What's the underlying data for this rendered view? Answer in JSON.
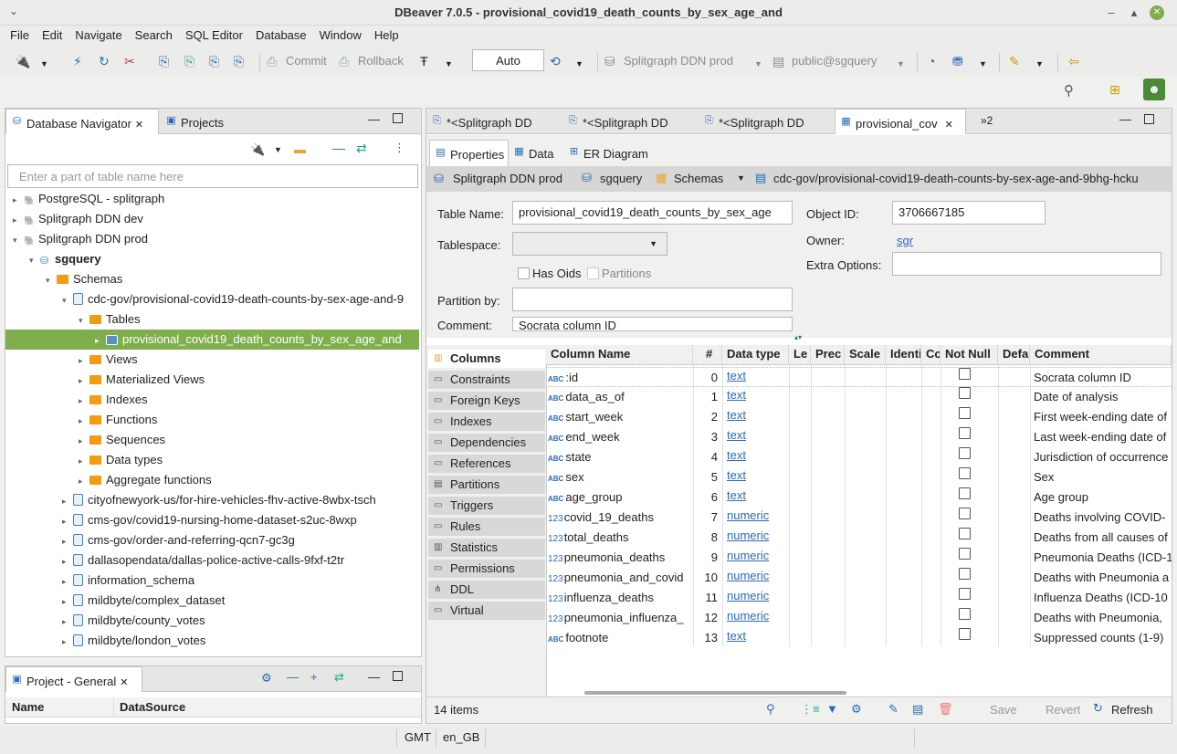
{
  "window": {
    "title": "DBeaver 7.0.5 - provisional_covid19_death_counts_by_sex_age_and",
    "min": "–",
    "max": "▴",
    "close": "✕"
  },
  "menu": [
    "File",
    "Edit",
    "Navigate",
    "Search",
    "SQL Editor",
    "Database",
    "Window",
    "Help"
  ],
  "toolbar": {
    "commit": "Commit",
    "rollback": "Rollback",
    "mode": "Auto",
    "connection": "Splitgraph DDN prod",
    "schema": "public@sgquery"
  },
  "navigator": {
    "tab": "Database Navigator",
    "tab2": "Projects",
    "filter_placeholder": "Enter a part of table name here",
    "rows": [
      {
        "label": "PostgreSQL - splitgraph",
        "lvl": 0,
        "kind": "db",
        "arrow": "▸"
      },
      {
        "label": "Splitgraph DDN dev",
        "lvl": 0,
        "kind": "db",
        "arrow": "▸"
      },
      {
        "label": "Splitgraph DDN prod",
        "lvl": 0,
        "kind": "db",
        "arrow": "▾"
      },
      {
        "label": "sgquery",
        "lvl": 1,
        "kind": "sg",
        "arrow": "▾"
      },
      {
        "label": "Schemas",
        "lvl": 2,
        "kind": "fold",
        "arrow": "▾"
      },
      {
        "label": "cdc-gov/provisional-covid19-death-counts-by-sex-age-and-9",
        "lvl": 3,
        "kind": "sch",
        "arrow": "▾"
      },
      {
        "label": "Tables",
        "lvl": 4,
        "kind": "fold",
        "arrow": "▾"
      },
      {
        "label": "provisional_covid19_death_counts_by_sex_age_and",
        "lvl": 5,
        "kind": "tbl",
        "arrow": "▸",
        "sel": true
      },
      {
        "label": "Views",
        "lvl": 4,
        "kind": "fold",
        "arrow": "▸"
      },
      {
        "label": "Materialized Views",
        "lvl": 4,
        "kind": "fold",
        "arrow": "▸"
      },
      {
        "label": "Indexes",
        "lvl": 4,
        "kind": "fold",
        "arrow": "▸"
      },
      {
        "label": "Functions",
        "lvl": 4,
        "kind": "fold",
        "arrow": "▸"
      },
      {
        "label": "Sequences",
        "lvl": 4,
        "kind": "fold",
        "arrow": "▸"
      },
      {
        "label": "Data types",
        "lvl": 4,
        "kind": "fold",
        "arrow": "▸"
      },
      {
        "label": "Aggregate functions",
        "lvl": 4,
        "kind": "fold",
        "arrow": "▸"
      },
      {
        "label": "cityofnewyork-us/for-hire-vehicles-fhv-active-8wbx-tsch",
        "lvl": 3,
        "kind": "sch",
        "arrow": "▸"
      },
      {
        "label": "cms-gov/covid19-nursing-home-dataset-s2uc-8wxp",
        "lvl": 3,
        "kind": "sch",
        "arrow": "▸"
      },
      {
        "label": "cms-gov/order-and-referring-qcn7-gc3g",
        "lvl": 3,
        "kind": "sch",
        "arrow": "▸"
      },
      {
        "label": "dallasopendata/dallas-police-active-calls-9fxf-t2tr",
        "lvl": 3,
        "kind": "sch",
        "arrow": "▸"
      },
      {
        "label": "information_schema",
        "lvl": 3,
        "kind": "sch",
        "arrow": "▸"
      },
      {
        "label": "mildbyte/complex_dataset",
        "lvl": 3,
        "kind": "sch",
        "arrow": "▸"
      },
      {
        "label": "mildbyte/county_votes",
        "lvl": 3,
        "kind": "sch",
        "arrow": "▸"
      },
      {
        "label": "mildbyte/london_votes",
        "lvl": 3,
        "kind": "sch",
        "arrow": "▸"
      }
    ]
  },
  "project": {
    "tab": "Project - General",
    "col_name": "Name",
    "col_ds": "DataSource"
  },
  "editor_tabs": [
    "*<Splitgraph DD",
    "*<Splitgraph DD",
    "*<Splitgraph DD",
    "provisional_cov"
  ],
  "editor_more": "»2",
  "subtabs": [
    "Properties",
    "Data",
    "ER Diagram"
  ],
  "breadcrumb": {
    "conn": "Splitgraph DDN prod",
    "db": "sgquery",
    "schemas": "Schemas",
    "path": "cdc-gov/provisional-covid19-death-counts-by-sex-age-and-9bhg-hcku"
  },
  "props": {
    "table_name_label": "Table Name:",
    "table_name": "provisional_covid19_death_counts_by_sex_age",
    "object_id_label": "Object ID:",
    "object_id": "3706667185",
    "tablespace_label": "Tablespace:",
    "owner_label": "Owner:",
    "owner": "sgr",
    "extra_label": "Extra Options:",
    "has_oids": "Has Oids",
    "partitions": "Partitions",
    "partition_by_label": "Partition by:",
    "comment_label": "Comment:",
    "comment": "Socrata column ID"
  },
  "sidetabs": [
    "Columns",
    "Constraints",
    "Foreign Keys",
    "Indexes",
    "Dependencies",
    "References",
    "Partitions",
    "Triggers",
    "Rules",
    "Statistics",
    "Permissions",
    "DDL",
    "Virtual"
  ],
  "grid": {
    "headers": [
      "Column Name",
      "#",
      "Data type",
      "Le",
      "Prec",
      "Scale",
      "Identi",
      "Co",
      "Not Null",
      "Defa",
      "Comment"
    ],
    "rows": [
      {
        "name": ":id",
        "n": "0",
        "type": "text",
        "kind": "abc",
        "comment": "Socrata column ID"
      },
      {
        "name": "data_as_of",
        "n": "1",
        "type": "text",
        "kind": "abc",
        "comment": "Date of analysis"
      },
      {
        "name": "start_week",
        "n": "2",
        "type": "text",
        "kind": "abc",
        "comment": "First week-ending date of"
      },
      {
        "name": "end_week",
        "n": "3",
        "type": "text",
        "kind": "abc",
        "comment": "Last week-ending date of"
      },
      {
        "name": "state",
        "n": "4",
        "type": "text",
        "kind": "abc",
        "comment": "Jurisdiction of occurrence"
      },
      {
        "name": "sex",
        "n": "5",
        "type": "text",
        "kind": "abc",
        "comment": "Sex"
      },
      {
        "name": "age_group",
        "n": "6",
        "type": "text",
        "kind": "abc",
        "comment": "Age group"
      },
      {
        "name": "covid_19_deaths",
        "n": "7",
        "type": "numeric",
        "kind": "num",
        "comment": "Deaths involving COVID-"
      },
      {
        "name": "total_deaths",
        "n": "8",
        "type": "numeric",
        "kind": "num",
        "comment": "Deaths from all causes of"
      },
      {
        "name": "pneumonia_deaths",
        "n": "9",
        "type": "numeric",
        "kind": "num",
        "comment": "Pneumonia Deaths (ICD-1"
      },
      {
        "name": "pneumonia_and_covid",
        "n": "10",
        "type": "numeric",
        "kind": "num",
        "comment": "Deaths with Pneumonia a"
      },
      {
        "name": "influenza_deaths",
        "n": "11",
        "type": "numeric",
        "kind": "num",
        "comment": "Influenza Deaths (ICD-10"
      },
      {
        "name": "pneumonia_influenza_",
        "n": "12",
        "type": "numeric",
        "kind": "num",
        "comment": "Deaths with Pneumonia,"
      },
      {
        "name": "footnote",
        "n": "13",
        "type": "text",
        "kind": "abc",
        "comment": "Suppressed counts (1-9)"
      }
    ]
  },
  "footer": {
    "count": "14 items",
    "save": "Save",
    "revert": "Revert",
    "refresh": "Refresh"
  },
  "statusbar": {
    "tz": "GMT",
    "locale": "en_GB"
  }
}
